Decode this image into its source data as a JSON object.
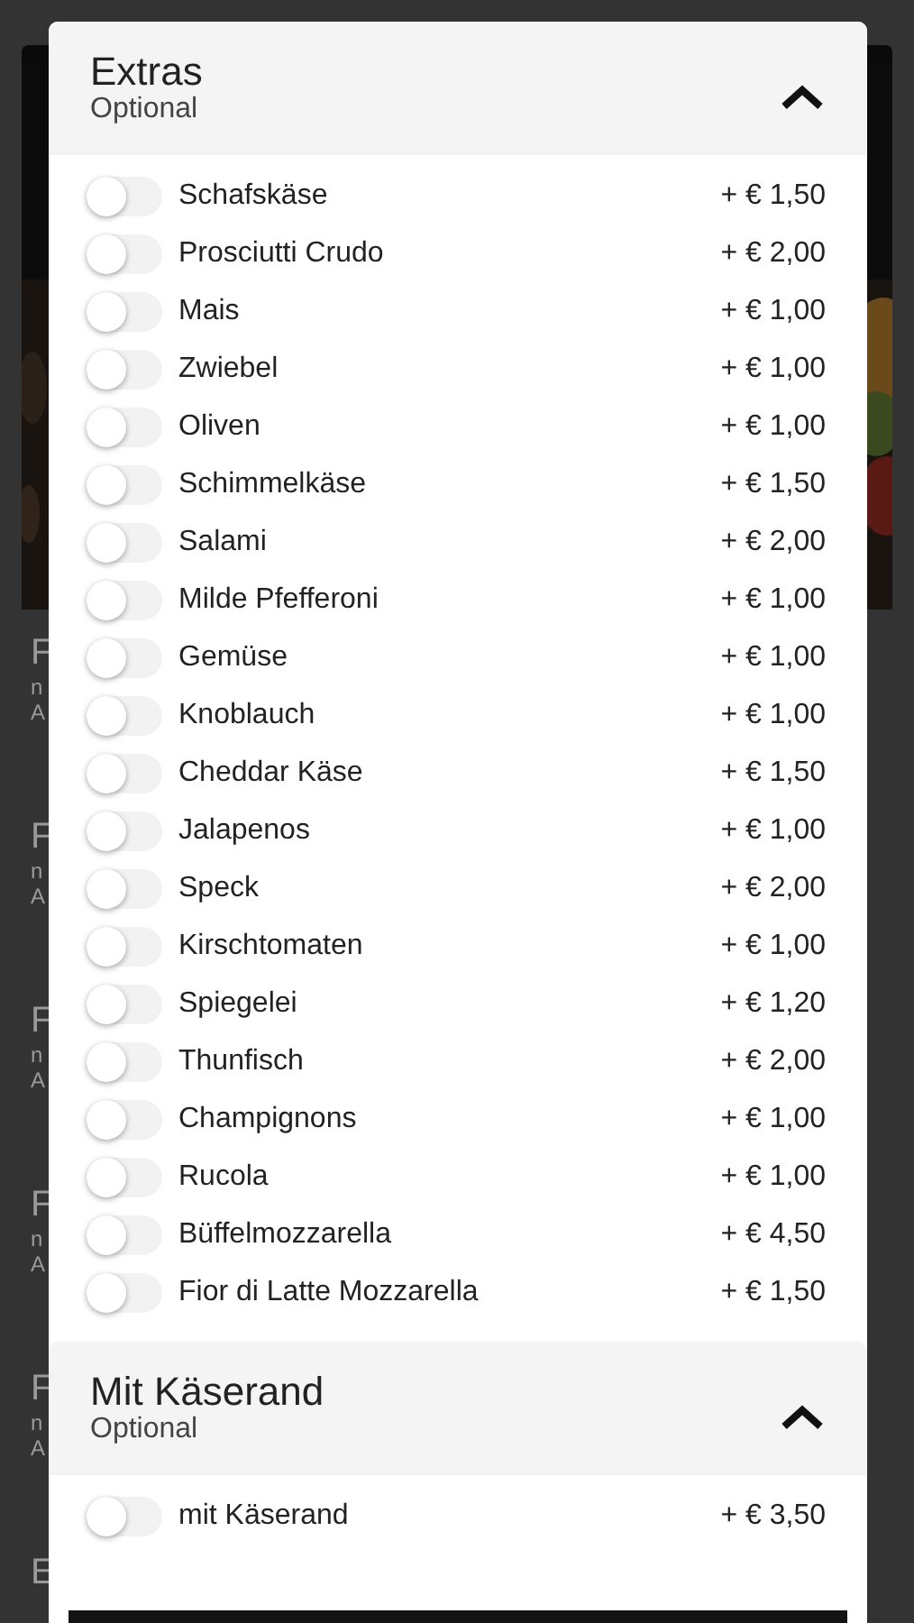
{
  "backdrop": {
    "items": [
      {
        "title": "F",
        "line_2": "n",
        "line_3": "A"
      },
      {
        "title": "F",
        "line_2": "n",
        "line_3": "A"
      },
      {
        "title": "F",
        "line_2": "n",
        "line_3": "A"
      },
      {
        "title": "F",
        "line_2": "n",
        "line_3": "A"
      },
      {
        "title": "F",
        "line_2": "n",
        "line_3": "A"
      }
    ],
    "next_heading": "E"
  },
  "sections": [
    {
      "title": "Extras",
      "subtitle": "Optional",
      "expanded": true,
      "options": [
        {
          "name": "Schafskäse",
          "price": "+ € 1,50",
          "on": false
        },
        {
          "name": "Prosciutti Crudo",
          "price": "+ € 2,00",
          "on": false
        },
        {
          "name": "Mais",
          "price": "+ € 1,00",
          "on": false
        },
        {
          "name": "Zwiebel",
          "price": "+ € 1,00",
          "on": false
        },
        {
          "name": "Oliven",
          "price": "+ € 1,00",
          "on": false
        },
        {
          "name": "Schimmelkäse",
          "price": "+ € 1,50",
          "on": false
        },
        {
          "name": "Salami",
          "price": "+ € 2,00",
          "on": false
        },
        {
          "name": "Milde Pfefferoni",
          "price": "+ € 1,00",
          "on": false
        },
        {
          "name": "Gemüse",
          "price": "+ € 1,00",
          "on": false
        },
        {
          "name": "Knoblauch",
          "price": "+ € 1,00",
          "on": false
        },
        {
          "name": "Cheddar Käse",
          "price": "+ € 1,50",
          "on": false
        },
        {
          "name": "Jalapenos",
          "price": "+ € 1,00",
          "on": false
        },
        {
          "name": "Speck",
          "price": "+ € 2,00",
          "on": false
        },
        {
          "name": "Kirschtomaten",
          "price": "+ € 1,00",
          "on": false
        },
        {
          "name": "Spiegelei",
          "price": "+ € 1,20",
          "on": false
        },
        {
          "name": "Thunfisch",
          "price": "+ € 2,00",
          "on": false
        },
        {
          "name": "Champignons",
          "price": "+ € 1,00",
          "on": false
        },
        {
          "name": "Rucola",
          "price": "+ € 1,00",
          "on": false
        },
        {
          "name": "Büffelmozzarella",
          "price": "+ € 4,50",
          "on": false
        },
        {
          "name": "Fior di Latte Mozzarella",
          "price": "+ € 1,50",
          "on": false
        }
      ]
    },
    {
      "title": "Mit Käserand",
      "subtitle": "Optional",
      "expanded": true,
      "options": [
        {
          "name": "mit Käserand",
          "price": "+ € 3,50",
          "on": false
        }
      ]
    }
  ]
}
